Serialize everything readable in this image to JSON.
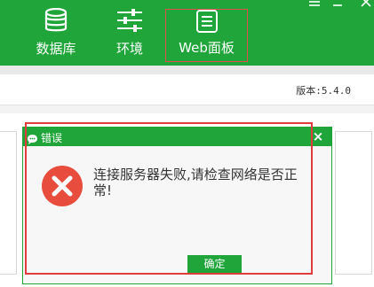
{
  "toolbar": {
    "items": [
      {
        "label": "数据库",
        "icon": "database-icon"
      },
      {
        "label": "环境",
        "icon": "sliders-icon"
      },
      {
        "label": "Web面板",
        "icon": "list-icon"
      }
    ],
    "window_controls": [
      "menu-icon",
      "minimize-icon",
      "close-icon"
    ]
  },
  "version_text": "版本:5.4.0",
  "dialog": {
    "title": "错误",
    "close_label": "×",
    "message": "连接服务器失败,请检查网络是否正常!",
    "ok_label": "确定"
  },
  "colors": {
    "brand_green": "#20a53a",
    "error_red": "#e84c3d",
    "highlight_red": "#e03c3c"
  }
}
